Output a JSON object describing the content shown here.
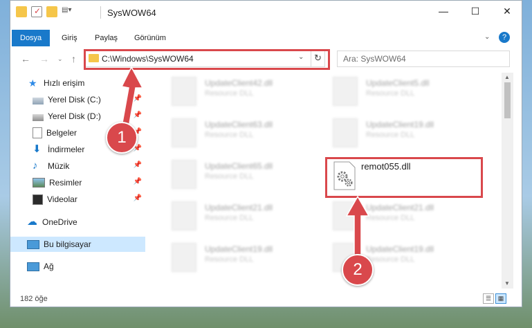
{
  "window": {
    "title": "SysWOW64"
  },
  "ribbon": {
    "tabs": [
      "Dosya",
      "Giriş",
      "Paylaş",
      "Görünüm"
    ]
  },
  "address": {
    "path": "C:\\Windows\\SysWOW64"
  },
  "search": {
    "placeholder": "Ara: SysWOW64"
  },
  "sidebar": {
    "items": [
      {
        "label": "Hızlı erişim",
        "icon": "star-icon"
      },
      {
        "label": "Yerel Disk (C:)",
        "icon": "drive-icon",
        "pinned": true
      },
      {
        "label": "Yerel Disk (D:)",
        "icon": "drive-icon",
        "pinned": true
      },
      {
        "label": "Belgeler",
        "icon": "documents-icon",
        "pinned": true
      },
      {
        "label": "İndirmeler",
        "icon": "download-icon",
        "pinned": true
      },
      {
        "label": "Müzik",
        "icon": "music-icon",
        "pinned": true
      },
      {
        "label": "Resimler",
        "icon": "pictures-icon",
        "pinned": true
      },
      {
        "label": "Videolar",
        "icon": "videos-icon",
        "pinned": true
      },
      {
        "label": "OneDrive",
        "icon": "cloud-icon"
      },
      {
        "label": "Bu bilgisayar",
        "icon": "computer-icon",
        "selected": true
      },
      {
        "label": "Ağ",
        "icon": "network-icon"
      }
    ]
  },
  "files": [
    {
      "name": "UpdateClient42.dll",
      "desc": "Resource DLL"
    },
    {
      "name": "UpdateClient5.dll",
      "desc": "Resource DLL"
    },
    {
      "name": "UpdateClient63.dll",
      "desc": "Resource DLL"
    },
    {
      "name": "UpdateClient19.dll",
      "desc": "Resource DLL"
    },
    {
      "name": "UpdateClient65.dll",
      "desc": "Resource DLL"
    },
    {
      "name": "remot055.dll",
      "desc": ""
    },
    {
      "name": "UpdateClient21.dll",
      "desc": "Resource DLL"
    },
    {
      "name": "UpdateClient21.dll",
      "desc": "Resource DLL"
    },
    {
      "name": "UpdateClient19.dll",
      "desc": "Resource DLL"
    },
    {
      "name": "UpdateClient19.dll",
      "desc": "Resource DLL"
    }
  ],
  "status": {
    "count": "182 öğe"
  },
  "callouts": [
    {
      "number": "1"
    },
    {
      "number": "2"
    }
  ],
  "colors": {
    "accent": "#1979ca",
    "highlight": "#d9484c",
    "selected": "#cde8ff"
  }
}
